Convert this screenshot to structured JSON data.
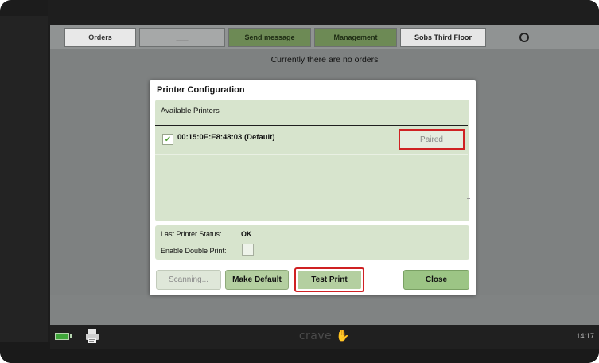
{
  "tabs": {
    "orders": "Orders",
    "blank": "___",
    "send_message": "Send message",
    "management": "Management",
    "location": "Sobs Third Floor"
  },
  "header": {
    "status_text": "Currently there are no orders"
  },
  "dialog": {
    "title": "Printer Configuration",
    "available_label": "Available Printers",
    "printers": [
      {
        "name": "00:15:0E:E8:48:03 (Default)",
        "checked": true,
        "status_button": "Paired"
      }
    ],
    "last_status_label": "Last Printer Status:",
    "last_status_value": "OK",
    "double_print_label": "Enable Double Print:",
    "double_print_checked": false,
    "buttons": {
      "scanning": "Scanning...",
      "make_default": "Make Default",
      "test_print": "Test Print",
      "close": "Close"
    }
  },
  "taskbar": {
    "brand": "crave",
    "clock": "14:17",
    "icons": [
      "battery-icon",
      "printer-icon",
      "hand-logo-icon"
    ]
  },
  "colors": {
    "panel_green": "#d7e4cd",
    "button_green": "#b4cfa0",
    "tab_green": "#6d8a55",
    "highlight_red": "#cf2123"
  }
}
